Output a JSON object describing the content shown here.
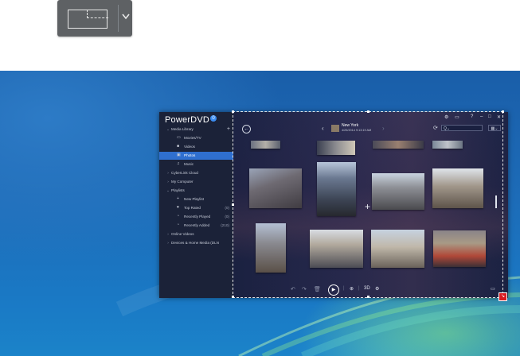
{
  "toolbar": {
    "capture_mode_icon": "region-select-icon",
    "dropdown_icon": "chevron-down-icon"
  },
  "app": {
    "logo": "PowerDVD",
    "logo_badge": "0",
    "sidebar": [
      {
        "label": "Media Library",
        "level": 0,
        "chevron": "⌄"
      },
      {
        "label": "Movies/TV",
        "level": 1,
        "icon": "movie-icon"
      },
      {
        "label": "Videos",
        "level": 1,
        "icon": "video-icon"
      },
      {
        "label": "Photos",
        "level": 1,
        "icon": "photo-icon",
        "active": true
      },
      {
        "label": "Music",
        "level": 1,
        "icon": "music-icon"
      },
      {
        "label": "CyberLink Cloud",
        "level": 0,
        "chevron": "›"
      },
      {
        "label": "My Computer",
        "level": 0,
        "chevron": "›"
      },
      {
        "label": "Playlists",
        "level": 0,
        "chevron": "⌄"
      },
      {
        "label": "New Playlist",
        "level": 1,
        "icon": "plus-icon"
      },
      {
        "label": "Top Rated",
        "level": 1,
        "icon": "heart-icon",
        "count": "(0)"
      },
      {
        "label": "Recently Played",
        "level": 1,
        "icon": "clock-icon",
        "count": "(0)"
      },
      {
        "label": "Recently Added",
        "level": 1,
        "icon": "clock-icon",
        "count": "(210)"
      },
      {
        "label": "Online Videos",
        "level": 0,
        "chevron": "›"
      },
      {
        "label": "Devices & Home Media (DLN",
        "level": 0,
        "chevron": "›"
      }
    ],
    "album": {
      "title": "New York",
      "date": "4/25/2014 9:13:19 AM"
    },
    "search_placeholder": "Q⌄",
    "view_label": "▦⌄",
    "window_controls": [
      "⚙",
      "▭",
      "?",
      "–",
      "□",
      "✕"
    ],
    "bottom": {
      "three_d": "3D"
    }
  },
  "colors": {
    "accent": "#2f6fcf",
    "window_bg": "#151a2e",
    "selection_handle": "#d81a20"
  }
}
